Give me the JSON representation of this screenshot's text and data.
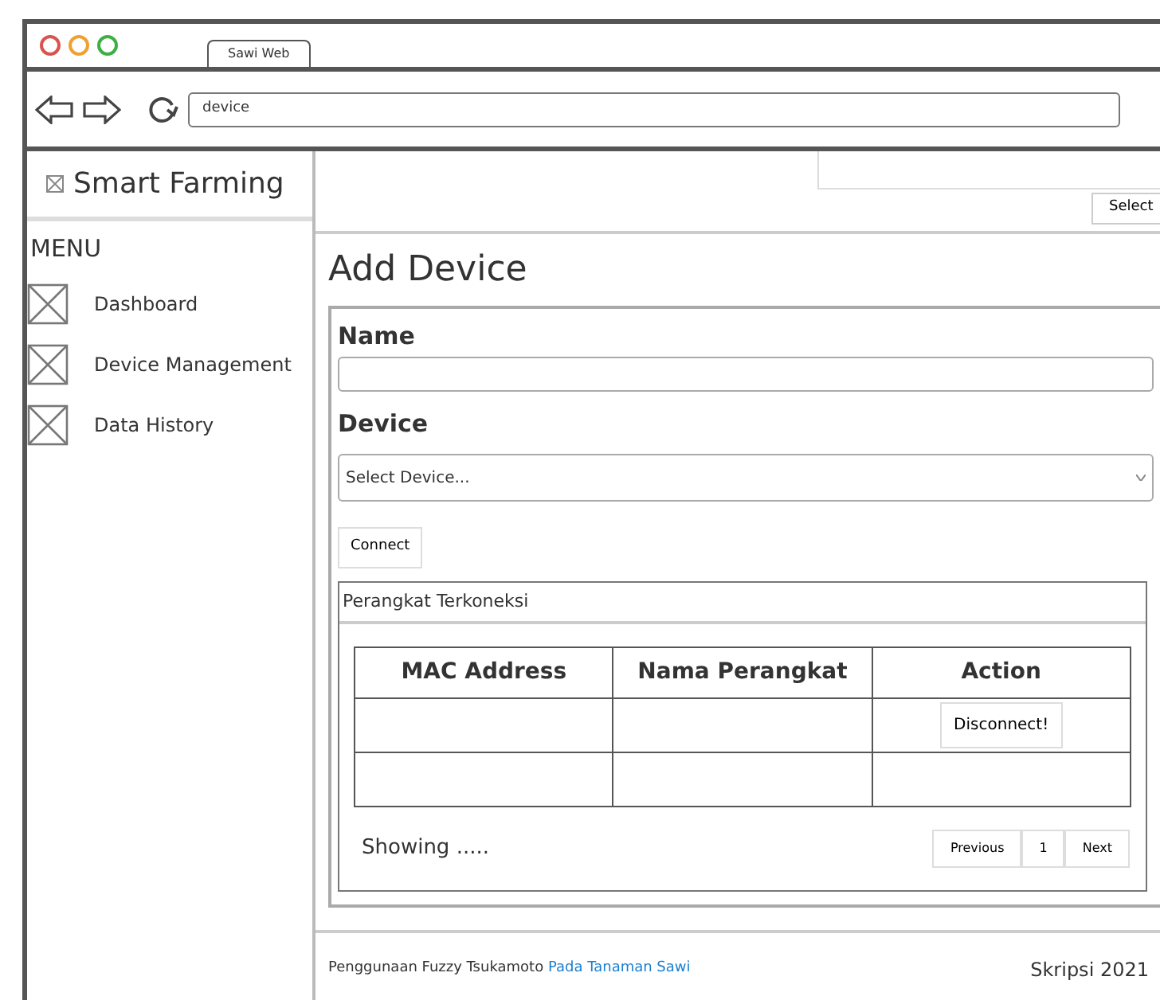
{
  "browser": {
    "tab": "Sawi Web",
    "address": "device"
  },
  "sidebar": {
    "brand": "Smart Farming",
    "menu_title": "MENU",
    "items": [
      {
        "label": "Dashboard"
      },
      {
        "label": "Device Management"
      },
      {
        "label": "Data History"
      }
    ]
  },
  "topbar": {
    "button": "Select"
  },
  "page": {
    "title": "Add Device",
    "form": {
      "name_label": "Name",
      "device_label": "Device",
      "device_placeholder": "Select Device...",
      "connect_button": "Connect"
    },
    "panel": {
      "title": "Perangkat Terkoneksi",
      "table": {
        "columns": [
          "MAC Address",
          "Nama Perangkat",
          "Action"
        ],
        "rows": [
          {
            "action": "Disconnect!"
          },
          {}
        ]
      },
      "showing": "Showing .....",
      "pagination": [
        "Previous",
        "1",
        "Next"
      ]
    }
  },
  "footer": {
    "text": "Penggunaan Fuzzy Tsukamoto",
    "link": "Pada Tanaman Sawi",
    "right": "Skripsi 2021"
  }
}
